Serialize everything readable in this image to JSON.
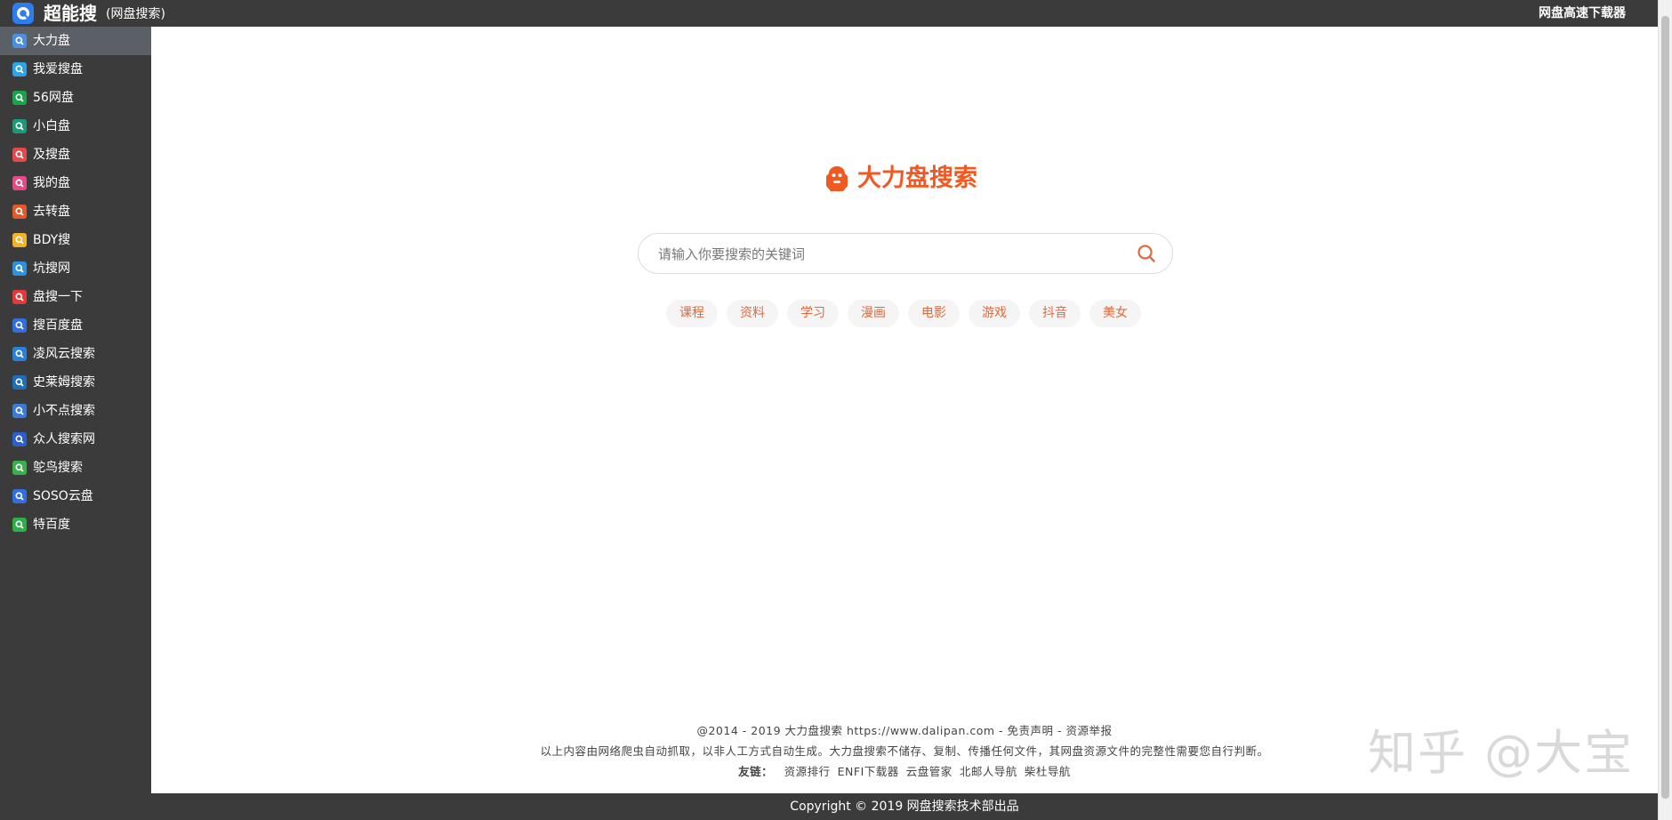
{
  "header": {
    "title": "超能搜",
    "subtitle": "(网盘搜索)",
    "right_link": "网盘高速下载器",
    "logo_icon": "cloud-search-icon"
  },
  "sidebar": {
    "items": [
      {
        "label": "大力盘",
        "icon": "dalipan-icon",
        "color": "#4a8fe0",
        "active": true
      },
      {
        "label": "我爱搜盘",
        "icon": "woaisoupan-icon",
        "color": "#2da3e8"
      },
      {
        "label": "56网盘",
        "icon": "search-green-icon",
        "color": "#1aa44a"
      },
      {
        "label": "小白盘",
        "icon": "xiaobaipan-icon",
        "color": "#1a9a7a"
      },
      {
        "label": "及搜盘",
        "icon": "jisoupan-icon",
        "color": "#e24b4b"
      },
      {
        "label": "我的盘",
        "icon": "wodepan-icon",
        "color": "#e34a88"
      },
      {
        "label": "去转盘",
        "icon": "quzhuanpan-icon",
        "color": "#e05a2a"
      },
      {
        "label": "BDY搜",
        "icon": "bdysou-icon",
        "color": "#f3b227"
      },
      {
        "label": "坑搜网",
        "icon": "kengsou-icon",
        "color": "#2f8fe0"
      },
      {
        "label": "盘搜一下",
        "icon": "pansou-icon",
        "color": "#e23a3a"
      },
      {
        "label": "搜百度盘",
        "icon": "soubaidupan-icon",
        "color": "#2f6fe0"
      },
      {
        "label": "凌风云搜索",
        "icon": "lingfengyun-icon",
        "color": "#2a80d8"
      },
      {
        "label": "史莱姆搜索",
        "icon": "slime-icon",
        "color": "#1d6fb8"
      },
      {
        "label": "小不点搜索",
        "icon": "xiaobudian-icon",
        "color": "#3a7ad8"
      },
      {
        "label": "众人搜索网",
        "icon": "zhongren-icon",
        "color": "#2a5fd0"
      },
      {
        "label": "鸵鸟搜索",
        "icon": "ostrich-icon",
        "color": "#3ab04a"
      },
      {
        "label": "SOSO云盘",
        "icon": "soso-icon",
        "color": "#2f6fe0"
      },
      {
        "label": "特百度",
        "icon": "tebaidu-icon",
        "color": "#2fae45"
      }
    ]
  },
  "brand": {
    "name": "大力盘搜索",
    "icon": "gorilla-logo-icon",
    "color": "#f05a22"
  },
  "search": {
    "placeholder": "请输入你要搜索的关键词",
    "value": "",
    "icon": "search-icon"
  },
  "tags": [
    "课程",
    "资料",
    "学习",
    "漫画",
    "电影",
    "游戏",
    "抖音",
    "美女"
  ],
  "footer": {
    "copyright_line": "@2014 - 2019 大力盘搜索 https://www.dalipan.com",
    "sep": " - ",
    "disclaimer_link": "免责声明",
    "report_link": "资源举报",
    "notice": "以上内容由网络爬虫自动抓取，以非人工方式自动生成。大力盘搜索不储存、复制、传播任何文件，其网盘资源文件的完整性需要您自行判断。",
    "friends_label": "友链：",
    "friends": [
      "资源排行",
      "ENFI下载器",
      "云盘管家",
      "北邮人导航",
      "柴杜导航"
    ]
  },
  "watermark": "知乎 @大宝",
  "bottom_bar": "Copyright © 2019 网盘搜索技术部出品"
}
